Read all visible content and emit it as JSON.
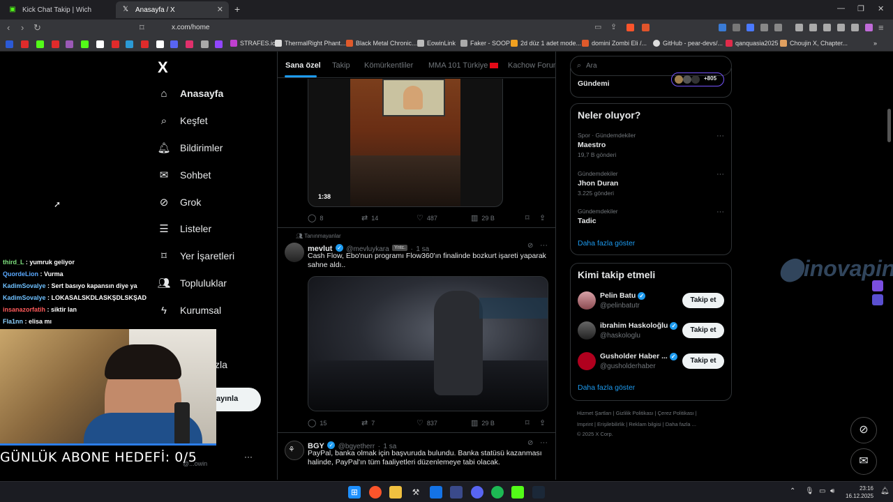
{
  "browser": {
    "tabs": [
      {
        "title": "Kick Chat Takip | Wich"
      },
      {
        "title": "Anasayfa / X"
      }
    ],
    "new_tab": "+",
    "url": "x.com/home",
    "bookmarks": [
      "STRAFES.io",
      "ThermalRight Phant...",
      "Black Metal Chronic...",
      "EowinLink",
      "Faker - SOOP",
      "2d düz 1 adet mode...",
      "domini Zombi Eli /...",
      "GitHub - pear-devs/...",
      "qanquasia2025",
      "Choujin X, Chapter..."
    ]
  },
  "sidebar": {
    "logo": "X",
    "items": [
      {
        "label": "Anasayfa",
        "icon": "home-icon"
      },
      {
        "label": "Keşfet",
        "icon": "search-icon"
      },
      {
        "label": "Bildirimler",
        "icon": "bell-icon"
      },
      {
        "label": "Sohbet",
        "icon": "mail-icon"
      },
      {
        "label": "Grok",
        "icon": "grok-icon"
      },
      {
        "label": "Listeler",
        "icon": "list-icon"
      },
      {
        "label": "Yer İşaretleri",
        "icon": "bookmark-icon"
      },
      {
        "label": "Topluluklar",
        "icon": "community-icon"
      },
      {
        "label": "Kurumsal",
        "icon": "lightning-icon"
      }
    ],
    "partial_label": "zla",
    "post_button": "ayınla",
    "account_handle": "@...owin"
  },
  "feed": {
    "tabs": [
      "Sana özel",
      "Takip",
      "Kömürkentliler",
      "MMA 101 Türkiye",
      "Kachow Forum"
    ],
    "post1": {
      "video_duration": "1:38",
      "replies": "8",
      "reposts": "14",
      "likes": "487",
      "views": "29 B"
    },
    "post2": {
      "context": "Tanınmayanlar",
      "name": "mevlut",
      "handle": "@mevluykara",
      "badge": "Yntc.",
      "time": "1 sa",
      "text": "Cash Flow, Ebo'nun programı Flow360'ın finalinde bozkurt işareti yaparak sahne aldı..",
      "replies": "15",
      "reposts": "7",
      "likes": "837",
      "views": "29 B"
    },
    "post3": {
      "name": "BGY",
      "handle": "@bgyetherr",
      "time": "1 sa",
      "text": "PayPal, banka olmak için başvuruda bulundu. Banka statüsü kazanması halinde, PayPal'ın tüm faaliyetleri düzenlemeye tabi olacak."
    }
  },
  "right": {
    "search_placeholder": "Ara",
    "top_partial": "Gündemi",
    "avatar_count": "+805",
    "trends_title": "Neler oluyor?",
    "trends": [
      {
        "category": "Spor · Gündemdekiler",
        "name": "Maestro",
        "count": "19,7 B gönderi"
      },
      {
        "category": "Gündemdekiler",
        "name": "Jhon Duran",
        "count": "3.225 gönderi"
      },
      {
        "category": "Gündemdekiler",
        "name": "Tadic",
        "count": ""
      }
    ],
    "show_more": "Daha fazla göster",
    "follow_title": "Kimi takip etmeli",
    "follow": [
      {
        "name": "Pelin Batu",
        "handle": "@pelinbatutr",
        "button": "Takip et"
      },
      {
        "name": "ibrahim Haskoloğlu",
        "handle": "@haskologlu",
        "button": "Takip et"
      },
      {
        "name": "Gusholder Haber ...",
        "handle": "@gusholderhaber",
        "button": "Takip et"
      }
    ],
    "footer_row1": [
      "Hizmet Şartları",
      "Gizlilik Politikası",
      "Çerez Politikası"
    ],
    "footer_row2": [
      "Imprint",
      "Erişilebilirlik",
      "Reklam bilgisi",
      "Daha fazla ..."
    ],
    "copyright": "© 2025 X Corp."
  },
  "overlay": {
    "chat": [
      {
        "user": "third_L",
        "msg": "yumruk geliyor",
        "color": "#7ee07e"
      },
      {
        "user": "QuordeLion",
        "msg": "Vurma",
        "color": "#5aa9ff"
      },
      {
        "user": "KadimSovalye",
        "msg": "Sert basıyo kapansın diye ya",
        "color": "#6ec0ff"
      },
      {
        "user": "KadimSovalye",
        "msg": "LOKASALSKDLASKŞDLSKŞAD",
        "color": "#6ec0ff"
      },
      {
        "user": "insanazorfatih",
        "msg": "siktir lan",
        "color": "#ff5a5a"
      },
      {
        "user": "Fla1nn",
        "msg": "elisa mı",
        "color": "#8fd3ff"
      }
    ],
    "goal": "GÜNLÜK ABONE HEDEFİ: 0/5",
    "watermark": "inovapin"
  },
  "taskbar": {
    "time": "23:16",
    "date": "16.12.2025"
  }
}
